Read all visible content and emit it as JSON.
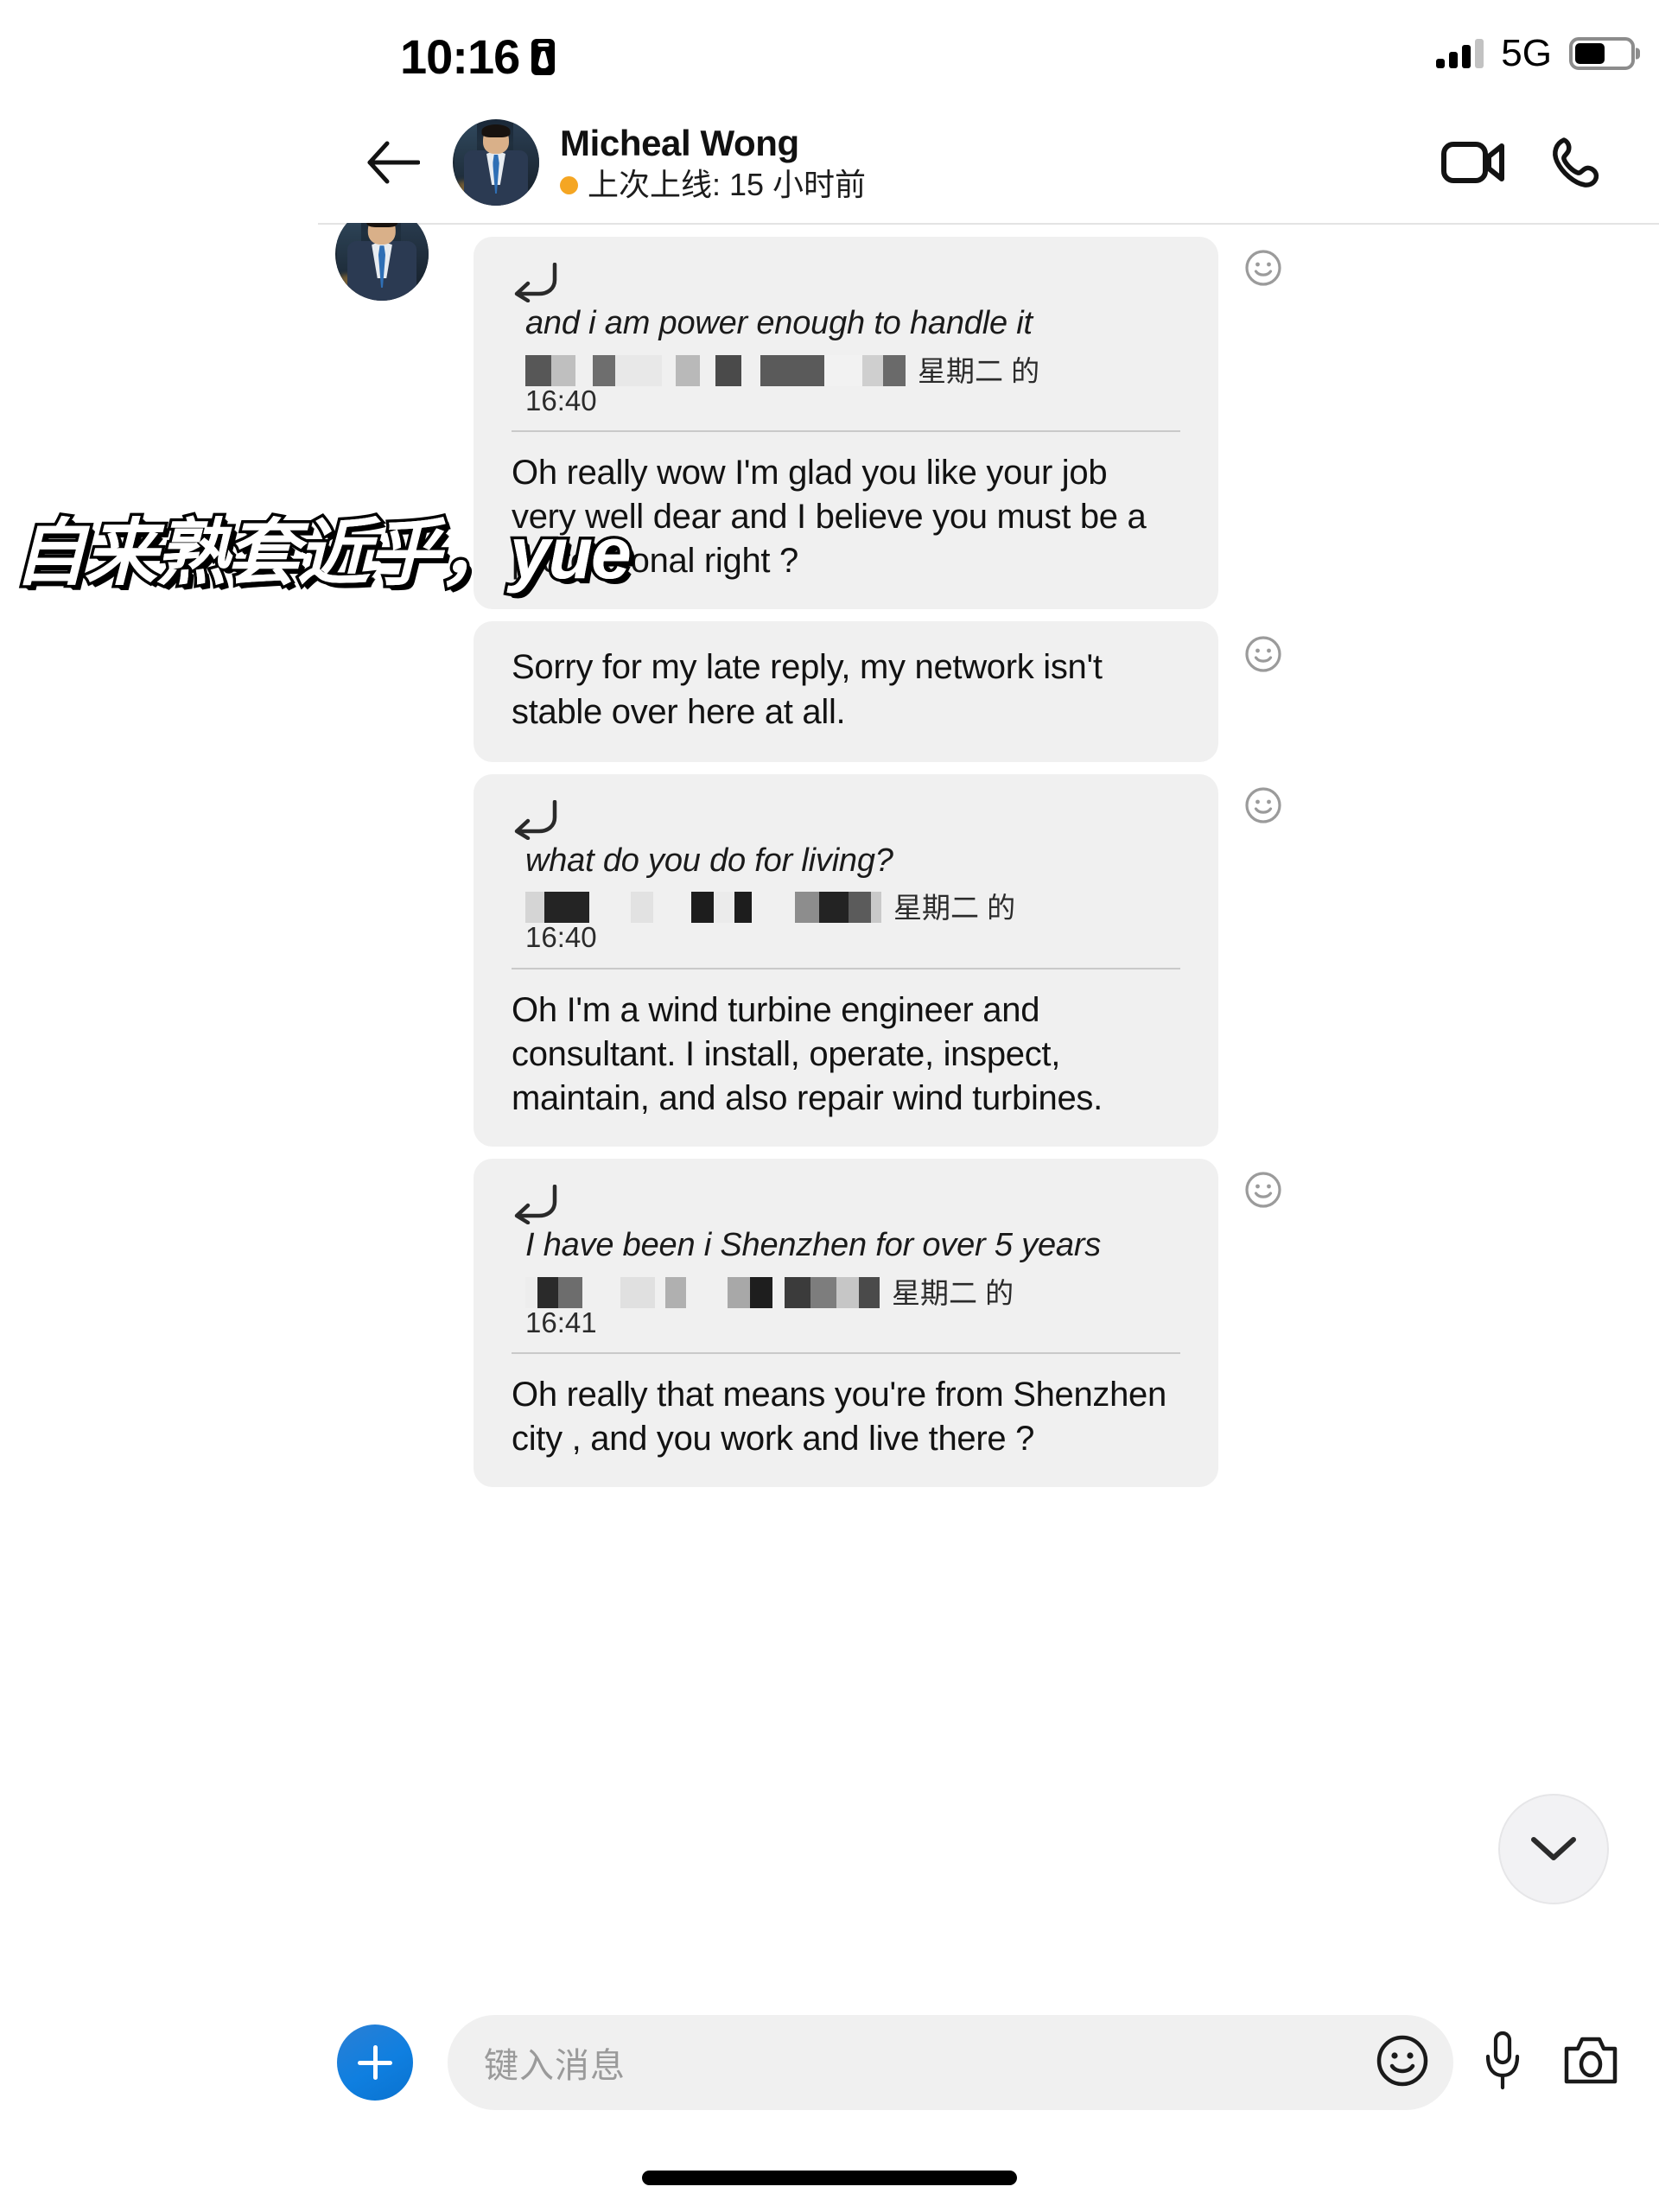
{
  "status_bar": {
    "time": "10:16",
    "badge_icon": "id-badge-icon",
    "signal_icon": "cellular-signal-icon",
    "signal_bars_filled": 3,
    "signal_bars_total": 4,
    "network": "5G",
    "battery_icon": "battery-icon",
    "battery_percent": 55
  },
  "header": {
    "back_icon": "back-arrow-icon",
    "avatar": "contact-avatar",
    "name": "Micheal Wong",
    "status_dot_color": "#f5a623",
    "last_seen": "上次上线: 15 小时前",
    "video_call_icon": "video-camera-icon",
    "voice_call_icon": "phone-handset-icon"
  },
  "watermark": {
    "text": "自来熟套近乎，yue"
  },
  "messages": [
    {
      "id": "msg-1",
      "has_quote": true,
      "reply_icon": "reply-arrow-icon",
      "quote_text": "and i am power enough to handle it",
      "quote_author": "[redacted]",
      "quote_day": "星期二 的",
      "quote_time": "16:40",
      "body": "Oh really wow I'm glad you like your job very well dear and I believe you must be a professional right ?",
      "reaction_icon": "smiley-reaction-icon"
    },
    {
      "id": "msg-2",
      "has_quote": false,
      "body": "Sorry for my late reply, my network isn't stable over here at all.",
      "reaction_icon": "smiley-reaction-icon"
    },
    {
      "id": "msg-3",
      "has_quote": true,
      "reply_icon": "reply-arrow-icon",
      "quote_text": "what do you do for living?",
      "quote_author": "[redacted],",
      "quote_day": "星期二 的",
      "quote_time": "16:40",
      "body": "Oh I'm a wind turbine engineer and consultant. I install, operate, inspect, maintain, and also repair wind turbines.",
      "reaction_icon": "smiley-reaction-icon"
    },
    {
      "id": "msg-4",
      "has_quote": true,
      "reply_icon": "reply-arrow-icon",
      "quote_text": "I have been i Shenzhen for over 5 years",
      "quote_author": "[redacted]",
      "quote_day": "星期二 的",
      "quote_time": "16:41",
      "body": "Oh really that means you're from Shenzhen city , and you work and live there ?",
      "reaction_icon": "smiley-reaction-icon"
    }
  ],
  "scroll_button": {
    "icon": "chevron-down-icon"
  },
  "composer": {
    "add_icon": "plus-icon",
    "placeholder": "键入消息",
    "value": "",
    "emoji_icon": "smiley-icon",
    "mic_icon": "microphone-icon",
    "camera_icon": "camera-icon"
  },
  "colors": {
    "bubble": "#f0f0f0",
    "accent_blue": "#0f7fe0",
    "status_orange": "#f5a623"
  }
}
